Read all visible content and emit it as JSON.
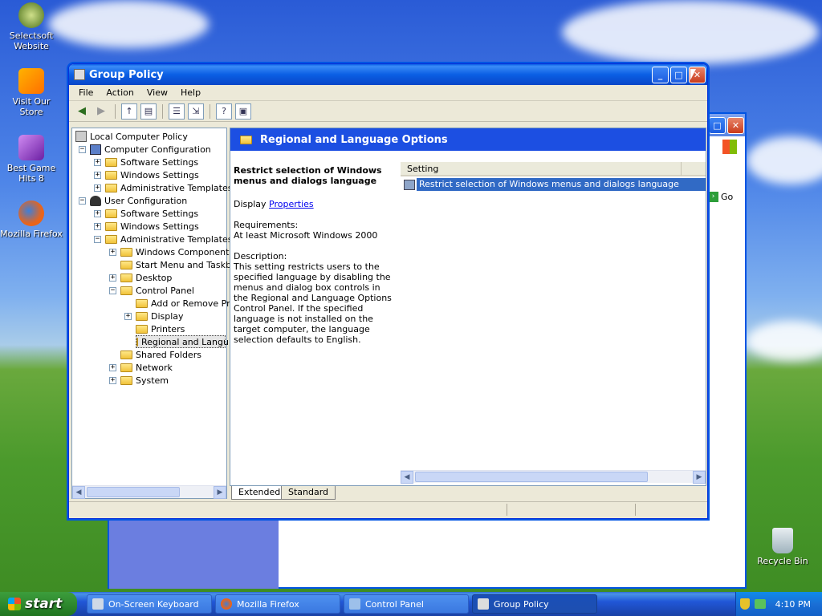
{
  "desktop": {
    "icons": [
      {
        "label": "Selectsoft Website",
        "icon": "selectsoft-icon"
      },
      {
        "label": "Visit Our Store",
        "icon": "store-icon"
      },
      {
        "label": "Best Game Hits 8",
        "icon": "game-cube-icon"
      },
      {
        "label": "Mozilla Firefox",
        "icon": "firefox-icon"
      },
      {
        "label": "Recycle Bin",
        "icon": "recycle-bin-icon"
      }
    ]
  },
  "background_window": {
    "go_label": "Go"
  },
  "window": {
    "title": "Group Policy",
    "menu": [
      "File",
      "Action",
      "View",
      "Help"
    ]
  },
  "tree": {
    "root": "Local Computer Policy",
    "items": [
      "Computer Configuration",
      "Software Settings",
      "Windows Settings",
      "Administrative Templates",
      "User Configuration",
      "Software Settings",
      "Windows Settings",
      "Administrative Templates",
      "Windows Components",
      "Start Menu and Taskba",
      "Desktop",
      "Control Panel",
      "Add or Remove Pro",
      "Display",
      "Printers",
      "Regional and Langu",
      "Shared Folders",
      "Network",
      "System"
    ]
  },
  "detail": {
    "banner": "Regional and Language Options",
    "heading": "Restrict selection of Windows menus and dialogs language",
    "display_prefix": "Display",
    "display_link": "Properties",
    "req_label": "Requirements:",
    "req_value": "At least Microsoft Windows 2000",
    "desc_label": "Description:",
    "desc_value": "This setting restricts users to the specified language by disabling the menus and dialog box controls in the Regional and Language Options Control Panel. If the specified language is not installed on the target computer, the language selection defaults to English.",
    "column_header": "Setting",
    "row": "Restrict selection of Windows menus and dialogs language"
  },
  "tabs": [
    "Extended",
    "Standard"
  ],
  "taskbar": {
    "start": "start",
    "tasks": [
      "On-Screen Keyboard",
      "Mozilla Firefox",
      "Control Panel",
      "Group Policy"
    ],
    "clock": "4:10 PM"
  },
  "colors": {
    "title_blue": "#0a5ee5",
    "banner_blue": "#1c4fe2",
    "selection_blue": "#316ac5"
  }
}
